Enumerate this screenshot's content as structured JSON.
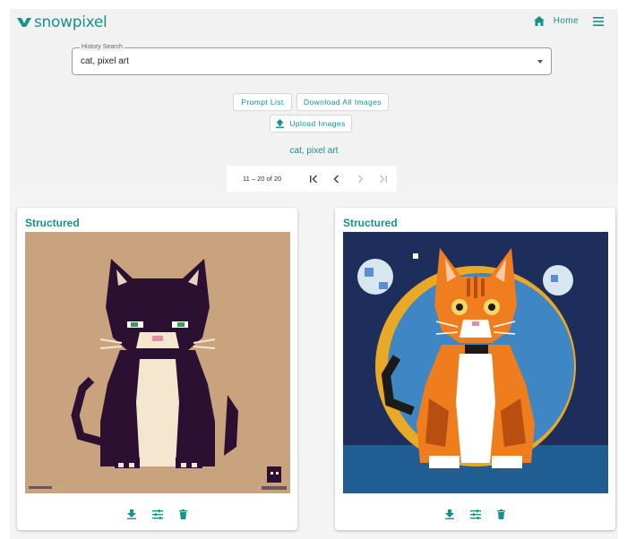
{
  "app": {
    "logo_text": "snowpixel",
    "brand_color": "#16928a",
    "nav": {
      "home_label": "Home",
      "home_icon": "home-icon",
      "menu_icon": "menu-icon"
    }
  },
  "search": {
    "legend": "History Search",
    "value": "cat, pixel art"
  },
  "buttons": {
    "prompt_list": "Prompt List",
    "download_all": "Download All Images",
    "upload": "Upload Images"
  },
  "query_label": "cat, pixel art",
  "pagination": {
    "range_text": "11 – 20 of 20",
    "first_icon": "first-page-icon",
    "prev_icon": "chevron-left-icon",
    "next_icon": "chevron-right-icon",
    "last_icon": "last-page-icon"
  },
  "cards": [
    {
      "title": "Structured",
      "image": "black and white pixel art cat sitting on tan background"
    },
    {
      "title": "Structured",
      "image": "orange pixel art cat sitting in front of blue circle on navy background"
    }
  ],
  "card_actions": [
    "download-icon",
    "tune-icon",
    "delete-icon"
  ]
}
